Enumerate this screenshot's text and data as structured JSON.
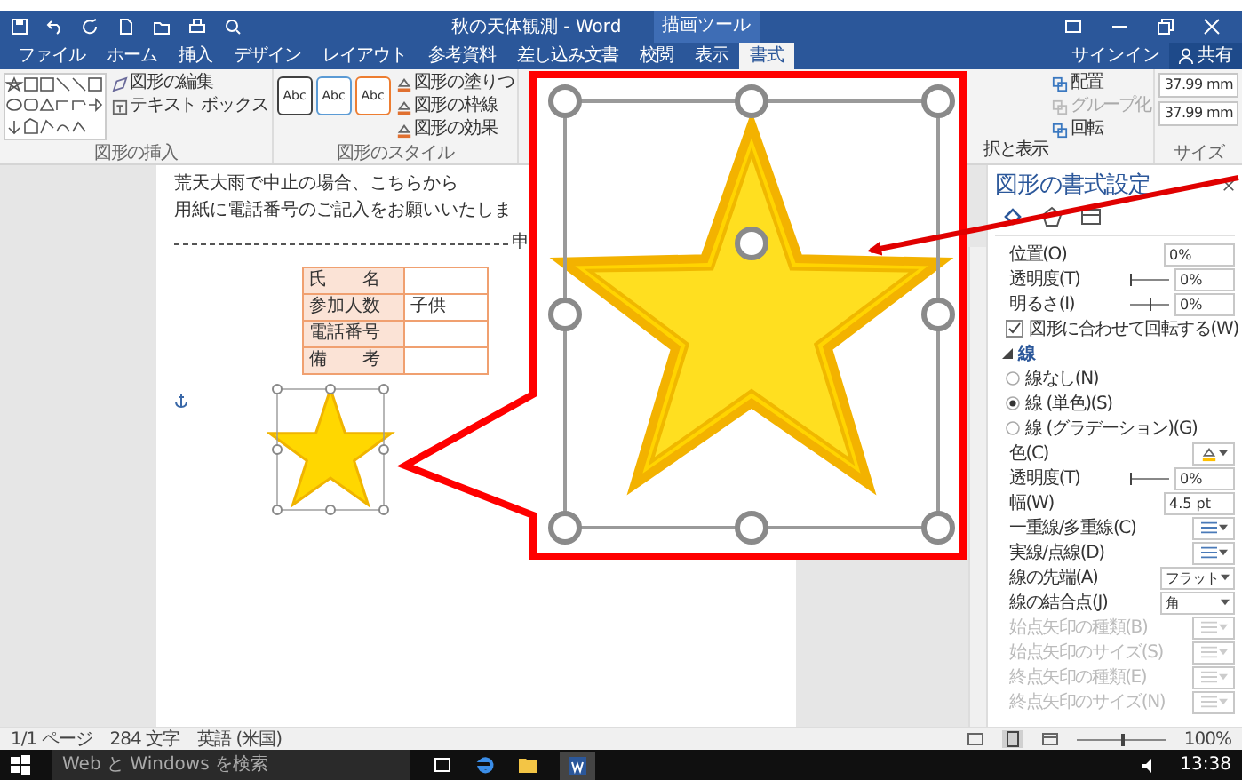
{
  "title_bar": {
    "title": "秋の天体観測 - Word",
    "context_label": "描画ツール",
    "sign_in": "サインイン",
    "share": "共有"
  },
  "tabs": [
    {
      "label": "ファイル",
      "selected": false
    },
    {
      "label": "ホーム",
      "selected": false
    },
    {
      "label": "挿入",
      "selected": false
    },
    {
      "label": "デザイン",
      "selected": false
    },
    {
      "label": "レイアウト",
      "selected": false
    },
    {
      "label": "参考資料",
      "selected": false
    },
    {
      "label": "差し込み文書",
      "selected": false
    },
    {
      "label": "校閲",
      "selected": false
    },
    {
      "label": "表示",
      "selected": false
    },
    {
      "label": "書式",
      "selected": true
    }
  ],
  "ribbon": {
    "insert_group_label": "図形の挿入",
    "edit_commands": [
      "図形の編集",
      "テキスト ボックス"
    ],
    "style_samples": [
      {
        "label": "Abc",
        "color": "#404040"
      },
      {
        "label": "Abc",
        "color": "#5b9bd5"
      },
      {
        "label": "Abc",
        "color": "#ed7d31"
      }
    ],
    "style_commands": [
      "図形の塗りつ",
      "図形の枠線",
      "図形の効果"
    ],
    "style_group_label": "図形のスタイル",
    "selection_pane": "択と表示",
    "arrange_commands": [
      {
        "label": "配置",
        "disabled": false
      },
      {
        "label": "グループ化",
        "disabled": true
      },
      {
        "label": "回転",
        "disabled": false
      }
    ],
    "size_values": [
      "37.99 mm",
      "37.99 mm"
    ],
    "size_group_label": "サイズ"
  },
  "document": {
    "lines": [
      "荒天大雨で中止の場合、こちらから",
      "用紙に電話番号のご記入をお願いいたしま"
    ],
    "cut_line_label": "申",
    "table_rows": [
      {
        "label": "氏　　名",
        "value": ""
      },
      {
        "label": "参加人数",
        "value": "子供"
      },
      {
        "label": "電話番号",
        "value": ""
      },
      {
        "label": "備　　考",
        "value": ""
      }
    ]
  },
  "pane": {
    "title": "図形の書式設定",
    "rows": [
      {
        "kind": "spin",
        "label": "位置(O)",
        "value": "0%"
      },
      {
        "kind": "slider",
        "label": "透明度(T)",
        "value": "0%",
        "level": 0
      },
      {
        "kind": "slider",
        "label": "明るさ(I)",
        "value": "0%",
        "level": 0.5
      },
      {
        "kind": "checkbox",
        "label": "図形に合わせて回転する(W)",
        "checked": true
      },
      {
        "kind": "section",
        "label": "線",
        "expanded": true
      },
      {
        "kind": "radio",
        "label": "線なし(N)",
        "selected": false
      },
      {
        "kind": "radio",
        "label": "線 (単色)(S)",
        "selected": true
      },
      {
        "kind": "radio",
        "label": "線 (グラデーション)(G)",
        "selected": false
      },
      {
        "kind": "color",
        "label": "色(C)"
      },
      {
        "kind": "slider",
        "label": "透明度(T)",
        "value": "0%",
        "level": 0
      },
      {
        "kind": "spin",
        "label": "幅(W)",
        "value": "4.5 pt"
      },
      {
        "kind": "icon_dropdown",
        "label": "一重線/多重線(C)",
        "disabled": false
      },
      {
        "kind": "icon_dropdown",
        "label": "実線/点線(D)",
        "disabled": false
      },
      {
        "kind": "dropdown",
        "label": "線の先端(A)",
        "value": "フラット"
      },
      {
        "kind": "dropdown",
        "label": "線の結合点(J)",
        "value": "角"
      },
      {
        "kind": "icon_dropdown",
        "label": "始点矢印の種類(B)",
        "disabled": true
      },
      {
        "kind": "icon_dropdown",
        "label": "始点矢印のサイズ(S)",
        "disabled": true
      },
      {
        "kind": "icon_dropdown",
        "label": "終点矢印の種類(E)",
        "disabled": true
      },
      {
        "kind": "icon_dropdown",
        "label": "終点矢印のサイズ(N)",
        "disabled": true
      }
    ]
  },
  "status_bar": {
    "items": [
      "1/1 ページ",
      "284 文字",
      "英語 (米国)"
    ],
    "zoom": "100%",
    "zoom_slider": {
      "level": 0.5
    }
  },
  "taskbar": {
    "search_placeholder": "Web と Windows を検索",
    "time": "13:38"
  }
}
